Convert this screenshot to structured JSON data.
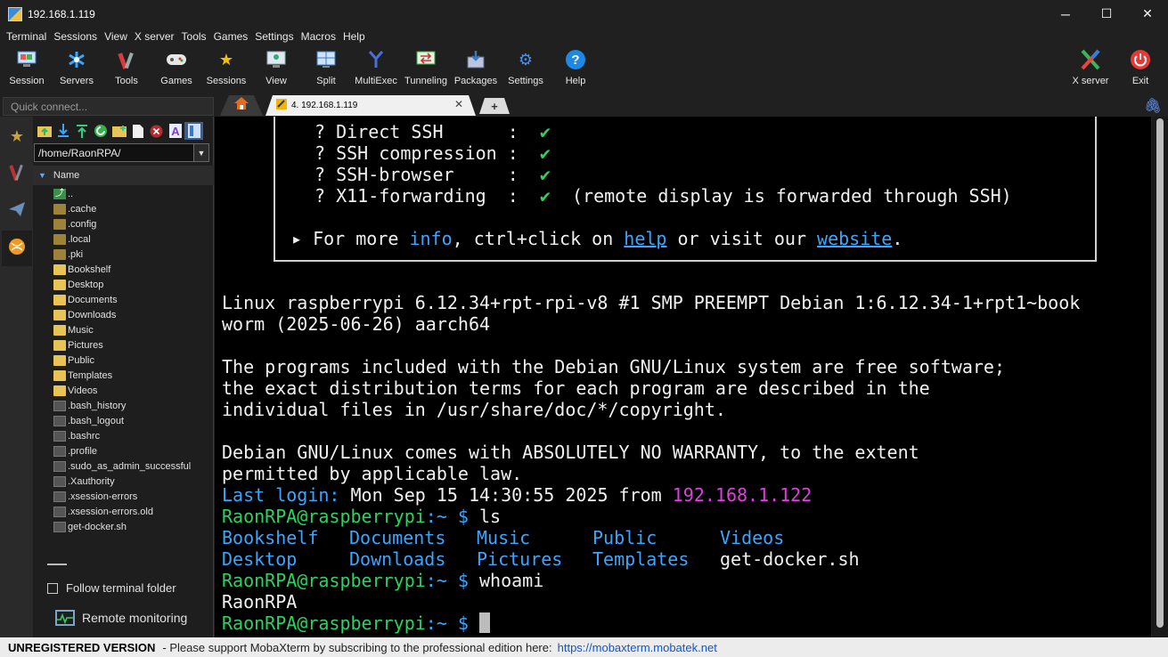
{
  "window": {
    "title": "192.168.1.119",
    "minimize": "─",
    "maximize": "☐",
    "close": "✕"
  },
  "menu": [
    "Terminal",
    "Sessions",
    "View",
    "X server",
    "Tools",
    "Games",
    "Settings",
    "Macros",
    "Help"
  ],
  "toolbar": {
    "session": "Session",
    "servers": "Servers",
    "tools": "Tools",
    "games": "Games",
    "sessions": "Sessions",
    "view": "View",
    "split": "Split",
    "multiexec": "MultiExec",
    "tunneling": "Tunneling",
    "packages": "Packages",
    "settings": "Settings",
    "help": "Help",
    "xserver": "X server",
    "exit": "Exit"
  },
  "quick_connect": {
    "placeholder": "Quick connect..."
  },
  "tabs": {
    "session_tab": "4. 192.168.1.119",
    "close": "✕",
    "new": "+"
  },
  "sidebar": {
    "path": "/home/RaonRPA/",
    "column_header": "Name",
    "files": [
      {
        "name": "..",
        "type": "up"
      },
      {
        "name": ".cache",
        "type": "hidden-folder"
      },
      {
        "name": ".config",
        "type": "hidden-folder"
      },
      {
        "name": ".local",
        "type": "hidden-folder"
      },
      {
        "name": ".pki",
        "type": "hidden-folder"
      },
      {
        "name": "Bookshelf",
        "type": "folder"
      },
      {
        "name": "Desktop",
        "type": "folder"
      },
      {
        "name": "Documents",
        "type": "folder"
      },
      {
        "name": "Downloads",
        "type": "folder"
      },
      {
        "name": "Music",
        "type": "folder"
      },
      {
        "name": "Pictures",
        "type": "folder"
      },
      {
        "name": "Public",
        "type": "folder"
      },
      {
        "name": "Templates",
        "type": "folder"
      },
      {
        "name": "Videos",
        "type": "folder"
      },
      {
        "name": ".bash_history",
        "type": "file"
      },
      {
        "name": ".bash_logout",
        "type": "file"
      },
      {
        "name": ".bashrc",
        "type": "file"
      },
      {
        "name": ".profile",
        "type": "file"
      },
      {
        "name": ".sudo_as_admin_successful",
        "type": "file"
      },
      {
        "name": ".Xauthority",
        "type": "file"
      },
      {
        "name": ".xsession-errors",
        "type": "file"
      },
      {
        "name": ".xsession-errors.old",
        "type": "file"
      },
      {
        "name": "get-docker.sh",
        "type": "file"
      }
    ],
    "follow_terminal": "Follow terminal folder",
    "remote_monitoring": "Remote monitoring"
  },
  "terminal": {
    "box_lines": [
      {
        "label": "? Direct SSH      :",
        "check": "✔",
        "note": ""
      },
      {
        "label": "? SSH compression :",
        "check": "✔",
        "note": ""
      },
      {
        "label": "? SSH-browser     :",
        "check": "✔",
        "note": ""
      },
      {
        "label": "? X11-forwarding  :",
        "check": "✔",
        "note": "(remote display is forwarded through SSH)"
      }
    ],
    "more": {
      "arrow": "▸",
      "p1": " For more ",
      "info": "info",
      "p2": ", ctrl+click on ",
      "help": "help",
      "p3": " or visit our ",
      "website": "website",
      "p4": "."
    },
    "uname1": "Linux raspberrypi 6.12.34+rpt-rpi-v8 #1 SMP PREEMPT Debian 1:6.12.34-1+rpt1~book",
    "uname2": "worm (2025-06-26) aarch64",
    "motd1": "The programs included with the Debian GNU/Linux system are free software;",
    "motd2": "the exact distribution terms for each program are described in the",
    "motd3": "individual files in /usr/share/doc/*/copyright.",
    "motd4": "Debian GNU/Linux comes with ABSOLUTELY NO WARRANTY, to the extent",
    "motd5": "permitted by applicable law.",
    "last_login_label": "Last login:",
    "last_login_text": " Mon Sep 15 14:30:55 2025 from ",
    "last_login_ip": "192.168.1.122",
    "prompt_user": "RaonRPA@raspberrypi",
    "prompt_path": ":~ $",
    "cmd1": " ls",
    "ls_row1": [
      "Bookshelf",
      "Documents",
      "Music",
      "Public",
      "Videos"
    ],
    "ls_row2": [
      "Desktop",
      "Downloads",
      "Pictures",
      "Templates",
      "get-docker.sh"
    ],
    "cmd2": " whoami",
    "whoami_out": "RaonRPA"
  },
  "status_bar": {
    "unregistered": "UNREGISTERED VERSION",
    "message": "-  Please support MobaXterm by subscribing to the professional edition here:",
    "url": "https://mobaxterm.mobatek.net"
  }
}
